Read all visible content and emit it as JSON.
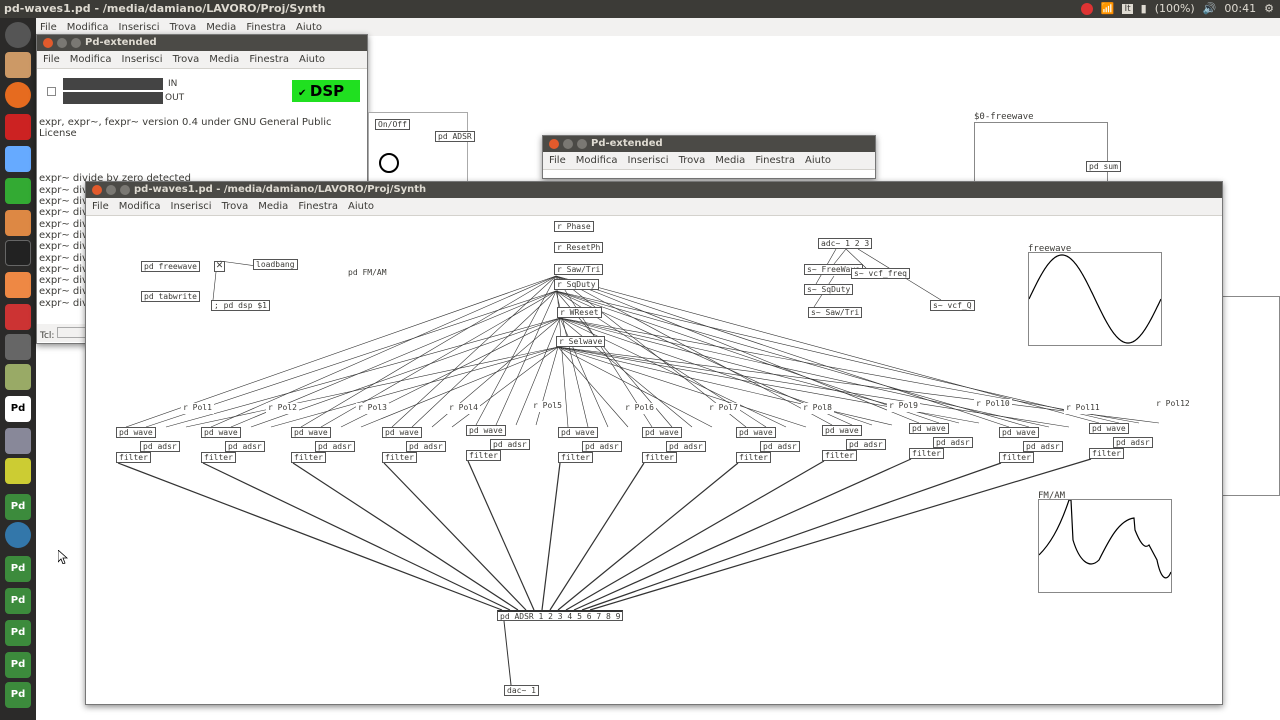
{
  "topbar": {
    "title": "pd-waves1.pd - /media/damiano/LAVORO/Proj/Synth",
    "battery": "(100%)",
    "time": "00:41",
    "lang": "It"
  },
  "menu": [
    "File",
    "Modifica",
    "Inserisci",
    "Trova",
    "Media",
    "Finestra",
    "Aiuto"
  ],
  "pdmain": {
    "title": "Pd-extended",
    "in_label": "IN",
    "out_label": "OUT",
    "dsp_label": "DSP",
    "console_lines": [
      "expr, expr~, fexpr~ version 0.4 under GNU General Public License",
      "",
      "",
      "",
      "",
      "expr~ divide by zero detected",
      "expr~ divide",
      "expr~ divide",
      "expr~ divide",
      "expr~ divide",
      "expr~ divide",
      "expr~ divide",
      "expr~ divide",
      "expr~ divide",
      "expr~ divide",
      "expr~ divide",
      "expr~ divide"
    ],
    "tcl": "Tcl:"
  },
  "pd2": {
    "title": "Pd-extended"
  },
  "patch": {
    "title": "pd-waves1.pd - /media/damiano/LAVORO/Proj/Synth",
    "top_objs": [
      "r Phase",
      "r ResetPh",
      "r Saw/Tri",
      "r SqDuty",
      "r WReset",
      "r Selwave"
    ],
    "misc": {
      "freewave": "pd freewave",
      "tabwrite": "pd tabwrite",
      "loadbang": "loadbang",
      "dsp": "; pd dsp $1",
      "fmam": "pd FM/AM",
      "adc": "adc~ 1 2 3",
      "s_free": "s~ FreeWave",
      "s_sq": "s~ SqDuty",
      "s_saw": "s~ Saw/Tri",
      "s_vcf": "s~ vcf_freq",
      "s_vcfq": "s~ vcf_Q",
      "adsr": "pd ADSR 1 2 3 4 5 6 7 8 9",
      "dac": "dac~ 1",
      "freewave_label": "freewave",
      "fmam_label": "FM/AM",
      "bg_freewave": "$0-freewave",
      "bg_sum": "pd sum"
    },
    "voices": [
      "r Pol1",
      "r Pol2",
      "r Pol3",
      "r Pol4",
      "r Pol5",
      "r Pol6",
      "r Pol7",
      "r Pol8",
      "r Pol9",
      "r Pol10",
      "r Pol11",
      "r Pol12"
    ],
    "wave_label": "pd wave",
    "adsr_label": "pd adsr",
    "filter_label": "filter"
  }
}
